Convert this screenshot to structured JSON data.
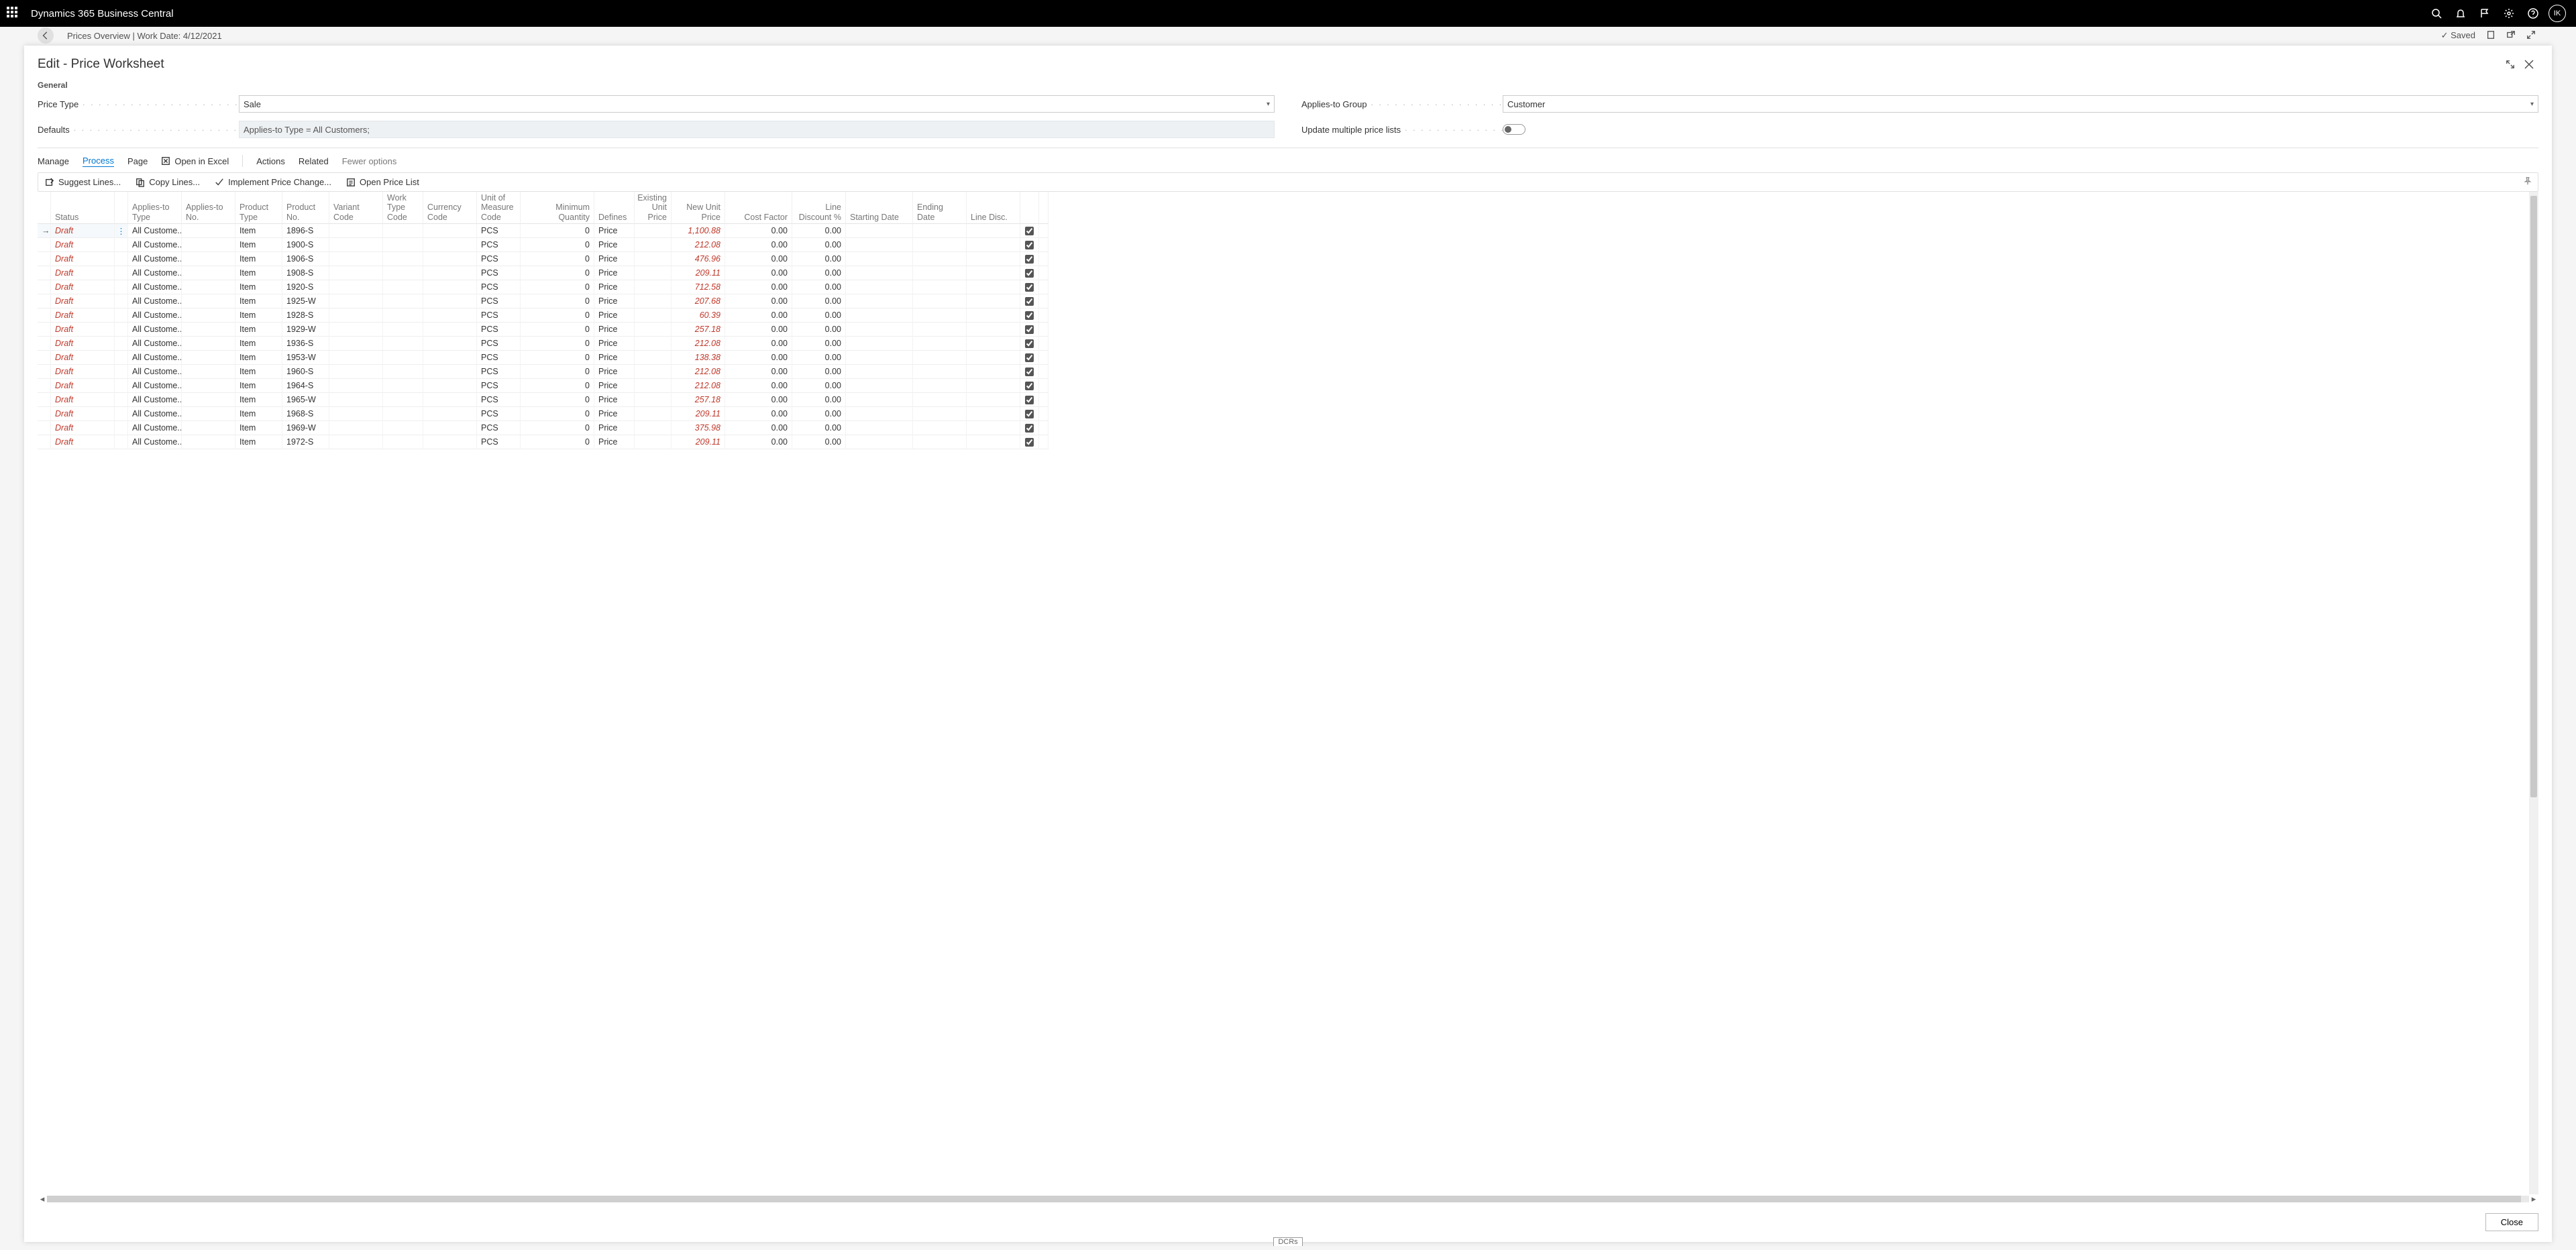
{
  "titlebar": {
    "app_name": "Dynamics 365 Business Central",
    "avatar_initials": "IK"
  },
  "background_page": {
    "breadcrumb": "Prices Overview | Work Date: 4/12/2021",
    "saved_label": "Saved"
  },
  "modal": {
    "title": "Edit - Price Worksheet",
    "section_general": "General",
    "fields": {
      "price_type_label": "Price Type",
      "price_type_value": "Sale",
      "defaults_label": "Defaults",
      "defaults_value": "Applies-to Type = All Customers;",
      "applies_to_group_label": "Applies-to Group",
      "applies_to_group_value": "Customer",
      "update_multiple_label": "Update multiple price lists"
    },
    "menubar": {
      "manage": "Manage",
      "process": "Process",
      "page": "Page",
      "open_excel": "Open in Excel",
      "actions": "Actions",
      "related": "Related",
      "fewer": "Fewer options"
    },
    "actions": {
      "suggest": "Suggest Lines...",
      "copy": "Copy Lines...",
      "implement": "Implement Price Change...",
      "open_list": "Open Price List"
    },
    "columns": {
      "status": "Status",
      "applies_to_type": "Applies-to Type",
      "applies_to_no": "Applies-to No.",
      "product_type": "Product Type",
      "product_no": "Product No.",
      "variant_code": "Variant Code",
      "work_type_code": "Work Type Code",
      "currency_code": "Currency Code",
      "uom_code": "Unit of Measure Code",
      "min_qty": "Minimum Quantity",
      "defines": "Defines",
      "existing_unit_price": "Existing Unit Price",
      "new_unit_price": "New Unit Price",
      "cost_factor": "Cost Factor",
      "line_discount": "Line Discount %",
      "starting_date": "Starting Date",
      "ending_date": "Ending Date",
      "line_disc": "Line Disc."
    },
    "rows": [
      {
        "status": "Draft",
        "applies_to_type": "All Custome...",
        "product_type": "Item",
        "product_no": "1896-S",
        "uom": "PCS",
        "min_qty": "0",
        "defines": "Price",
        "new_unit_price": "1,100.88",
        "cost_factor": "0.00",
        "line_discount": "0.00"
      },
      {
        "status": "Draft",
        "applies_to_type": "All Custome...",
        "product_type": "Item",
        "product_no": "1900-S",
        "uom": "PCS",
        "min_qty": "0",
        "defines": "Price",
        "new_unit_price": "212.08",
        "cost_factor": "0.00",
        "line_discount": "0.00"
      },
      {
        "status": "Draft",
        "applies_to_type": "All Custome...",
        "product_type": "Item",
        "product_no": "1906-S",
        "uom": "PCS",
        "min_qty": "0",
        "defines": "Price",
        "new_unit_price": "476.96",
        "cost_factor": "0.00",
        "line_discount": "0.00"
      },
      {
        "status": "Draft",
        "applies_to_type": "All Custome...",
        "product_type": "Item",
        "product_no": "1908-S",
        "uom": "PCS",
        "min_qty": "0",
        "defines": "Price",
        "new_unit_price": "209.11",
        "cost_factor": "0.00",
        "line_discount": "0.00"
      },
      {
        "status": "Draft",
        "applies_to_type": "All Custome...",
        "product_type": "Item",
        "product_no": "1920-S",
        "uom": "PCS",
        "min_qty": "0",
        "defines": "Price",
        "new_unit_price": "712.58",
        "cost_factor": "0.00",
        "line_discount": "0.00"
      },
      {
        "status": "Draft",
        "applies_to_type": "All Custome...",
        "product_type": "Item",
        "product_no": "1925-W",
        "uom": "PCS",
        "min_qty": "0",
        "defines": "Price",
        "new_unit_price": "207.68",
        "cost_factor": "0.00",
        "line_discount": "0.00"
      },
      {
        "status": "Draft",
        "applies_to_type": "All Custome...",
        "product_type": "Item",
        "product_no": "1928-S",
        "uom": "PCS",
        "min_qty": "0",
        "defines": "Price",
        "new_unit_price": "60.39",
        "cost_factor": "0.00",
        "line_discount": "0.00"
      },
      {
        "status": "Draft",
        "applies_to_type": "All Custome...",
        "product_type": "Item",
        "product_no": "1929-W",
        "uom": "PCS",
        "min_qty": "0",
        "defines": "Price",
        "new_unit_price": "257.18",
        "cost_factor": "0.00",
        "line_discount": "0.00"
      },
      {
        "status": "Draft",
        "applies_to_type": "All Custome...",
        "product_type": "Item",
        "product_no": "1936-S",
        "uom": "PCS",
        "min_qty": "0",
        "defines": "Price",
        "new_unit_price": "212.08",
        "cost_factor": "0.00",
        "line_discount": "0.00"
      },
      {
        "status": "Draft",
        "applies_to_type": "All Custome...",
        "product_type": "Item",
        "product_no": "1953-W",
        "uom": "PCS",
        "min_qty": "0",
        "defines": "Price",
        "new_unit_price": "138.38",
        "cost_factor": "0.00",
        "line_discount": "0.00"
      },
      {
        "status": "Draft",
        "applies_to_type": "All Custome...",
        "product_type": "Item",
        "product_no": "1960-S",
        "uom": "PCS",
        "min_qty": "0",
        "defines": "Price",
        "new_unit_price": "212.08",
        "cost_factor": "0.00",
        "line_discount": "0.00"
      },
      {
        "status": "Draft",
        "applies_to_type": "All Custome...",
        "product_type": "Item",
        "product_no": "1964-S",
        "uom": "PCS",
        "min_qty": "0",
        "defines": "Price",
        "new_unit_price": "212.08",
        "cost_factor": "0.00",
        "line_discount": "0.00"
      },
      {
        "status": "Draft",
        "applies_to_type": "All Custome...",
        "product_type": "Item",
        "product_no": "1965-W",
        "uom": "PCS",
        "min_qty": "0",
        "defines": "Price",
        "new_unit_price": "257.18",
        "cost_factor": "0.00",
        "line_discount": "0.00"
      },
      {
        "status": "Draft",
        "applies_to_type": "All Custome...",
        "product_type": "Item",
        "product_no": "1968-S",
        "uom": "PCS",
        "min_qty": "0",
        "defines": "Price",
        "new_unit_price": "209.11",
        "cost_factor": "0.00",
        "line_discount": "0.00"
      },
      {
        "status": "Draft",
        "applies_to_type": "All Custome...",
        "product_type": "Item",
        "product_no": "1969-W",
        "uom": "PCS",
        "min_qty": "0",
        "defines": "Price",
        "new_unit_price": "375.98",
        "cost_factor": "0.00",
        "line_discount": "0.00"
      },
      {
        "status": "Draft",
        "applies_to_type": "All Custome...",
        "product_type": "Item",
        "product_no": "1972-S",
        "uom": "PCS",
        "min_qty": "0",
        "defines": "Price",
        "new_unit_price": "209.11",
        "cost_factor": "0.00",
        "line_discount": "0.00"
      }
    ],
    "close_button": "Close"
  },
  "bottom_tag": "DCRs"
}
